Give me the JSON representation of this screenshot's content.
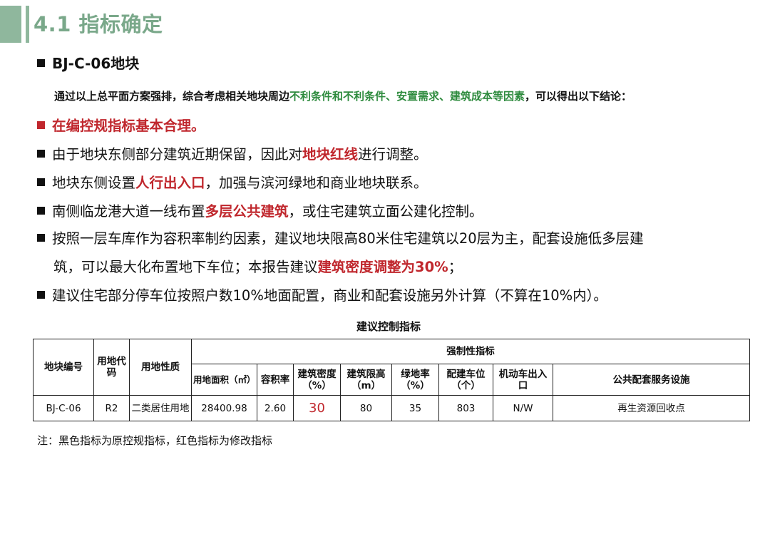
{
  "header": {
    "title": "4.1 指标确定"
  },
  "section": {
    "title": "BJ-C-06地块"
  },
  "intro": {
    "pre": "通过以上总平面方案强排，综合考虑相关地块周边",
    "highlight": "不利条件和不利条件、安置需求、建筑成本等因素",
    "post": "，可以得出以下结论："
  },
  "bullets": [
    {
      "text": "在编控规指标基本合理。"
    },
    {
      "pre": "由于地块东侧部分建筑近期保留，因此对",
      "highlight": "地块红线",
      "post": "进行调整。"
    },
    {
      "pre": "地块东侧设置",
      "highlight": "人行出入口",
      "post": "，加强与滨河绿地和商业地块联系。"
    },
    {
      "pre": "南侧临龙港大道一线布置",
      "highlight": "多层公共建筑",
      "post": "，或住宅建筑立面公建化控制。"
    },
    {
      "line1": "按照一层车库作为容积率制约因素，建议地块限高80米住宅建筑以20层为主，配套设施低多层建",
      "line2_pre": "筑，可以最大化布置地下车位；本报告建议",
      "line2_highlight": "建筑密度调整为30%",
      "line2_post": "；"
    },
    {
      "text": "建议住宅部分停车位按照户数10%地面配置，商业和配套设施另外计算（不算在10%内）。"
    }
  ],
  "table": {
    "caption": "建议控制指标",
    "headers": {
      "plot_id": "地块编号",
      "land_code": "用地代码",
      "land_nature": "用地性质",
      "mandatory": "强制性指标",
      "area": "用地面积（㎡）",
      "far": "容积率",
      "density": "建筑密度（%）",
      "height": "建筑限高（m）",
      "green": "绿地率（%）",
      "parking": "配建车位（个）",
      "vehicle_entry": "机动车出入口",
      "facilities": "公共配套服务设施"
    },
    "row": {
      "plot_id": "BJ-C-06",
      "land_code": "R2",
      "land_nature": "二类居住用地",
      "area": "28400.98",
      "far": "2.60",
      "density": "30",
      "height": "80",
      "green": "35",
      "parking": "803",
      "vehicle_entry": "N/W",
      "facilities": "再生资源回收点"
    }
  },
  "note": "注：黑色指标为原控规指标，红色指标为修改指标",
  "colors": {
    "accent_green": "#7aa88a",
    "highlight_green": "#2e8b3e",
    "highlight_red": "#c0272d"
  }
}
